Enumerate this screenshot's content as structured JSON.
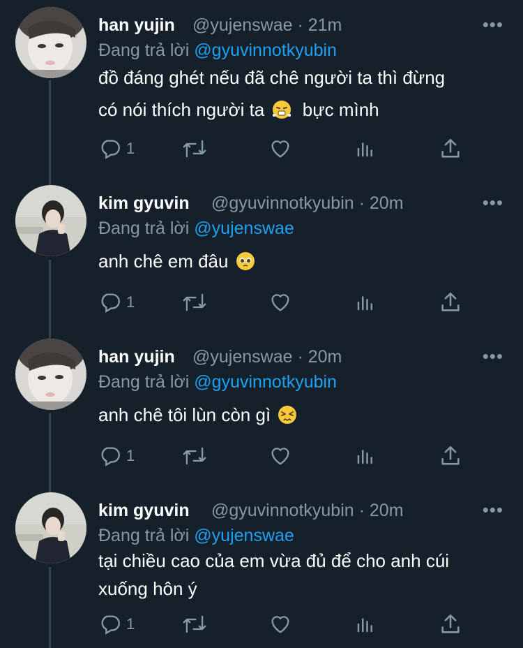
{
  "reply_prefix": "Đang trả lời",
  "tweets": [
    {
      "name": "han yujin",
      "handle": "@yujenswae",
      "time": "21m",
      "replying_to": "@gyuvinnotkyubin",
      "text_line1": "đồ đáng ghét nếu đã chê người ta thì đừng",
      "text_line2_before": "có nói thích người ta",
      "text_line2_after": "bực mình",
      "emoji": "huffing-face-emoji",
      "reply_count": "1"
    },
    {
      "name": "kim gyuvin",
      "handle": "@gyuvinnotkyubin",
      "time": "20m",
      "replying_to": "@yujenswae",
      "text": "anh chê em đâu",
      "emoji": "pleading-face-emoji",
      "reply_count": "1"
    },
    {
      "name": "han yujin",
      "handle": "@yujenswae",
      "time": "20m",
      "replying_to": "@gyuvinnotkyubin",
      "text": "anh chê tôi lùn còn gì",
      "emoji": "persevering-face-emoji",
      "reply_count": "1"
    },
    {
      "name": "kim gyuvin",
      "handle": "@gyuvinnotkyubin",
      "time": "20m",
      "replying_to": "@yujenswae",
      "text_line1": "tại chiều cao của em vừa đủ để cho anh cúi",
      "text_line2": "xuống hôn ý",
      "reply_count": "1"
    }
  ],
  "icons": [
    "reply-icon",
    "retweet-icon",
    "like-icon",
    "analytics-icon",
    "share-icon",
    "more-icon"
  ],
  "colors": {
    "background": "#15202b",
    "muted": "#8899a6",
    "link": "#1da1f2",
    "thread_line": "#38444d"
  }
}
